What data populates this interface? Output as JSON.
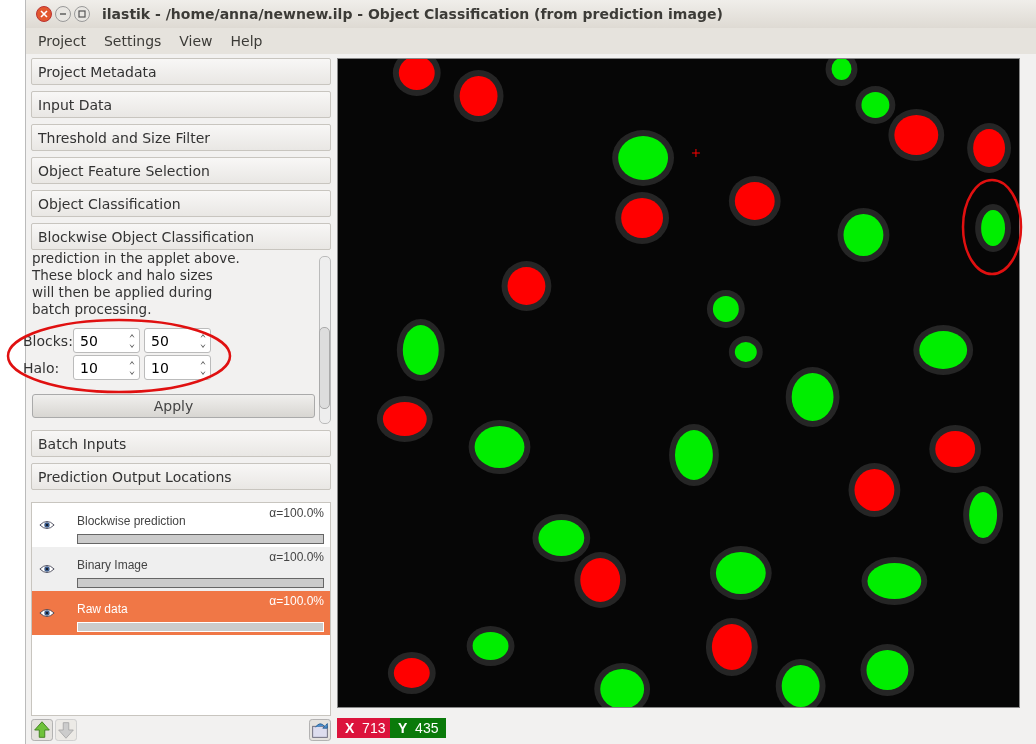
{
  "window": {
    "title": "ilastik - /home/anna/newnew.ilp - Object Classification (from prediction image)"
  },
  "menu": [
    {
      "label": "Project"
    },
    {
      "label": "Settings"
    },
    {
      "label": "View"
    },
    {
      "label": "Help"
    }
  ],
  "applets_top": [
    {
      "label": "Project Metadata"
    },
    {
      "label": "Input Data"
    },
    {
      "label": "Threshold and Size Filter"
    },
    {
      "label": "Object Feature Selection"
    },
    {
      "label": "Object Classification"
    },
    {
      "label": "Blockwise Object Classification"
    }
  ],
  "blockwise": {
    "description": "prediction in the applet above.\nThese block and halo sizes\nwill then be applied during\nbatch processing.",
    "rows": [
      {
        "label": "Blocks:",
        "values": [
          "50",
          "50"
        ]
      },
      {
        "label": "Halo:",
        "values": [
          "10",
          "10"
        ]
      }
    ],
    "apply": "Apply"
  },
  "applets_bottom": [
    {
      "label": "Batch Inputs"
    },
    {
      "label": "Prediction Output Locations"
    }
  ],
  "layers": [
    {
      "name": "Blockwise prediction",
      "opacity": "α=100.0%",
      "level": 1.0,
      "selected": false
    },
    {
      "name": "Binary Image",
      "opacity": "α=100.0%",
      "level": 1.0,
      "selected": false
    },
    {
      "name": "Raw data",
      "opacity": "α=100.0%",
      "level": 1.0,
      "selected": true
    }
  ],
  "coords": {
    "x_label": "X",
    "x_value": "713",
    "y_label": "Y",
    "y_value": "435"
  }
}
